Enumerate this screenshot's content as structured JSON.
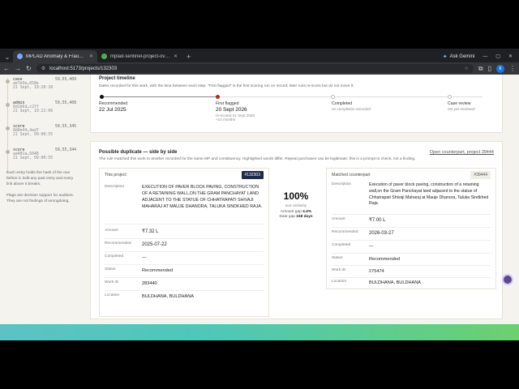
{
  "browser": {
    "tabs": [
      {
        "title": "MPLAD Anomaly & Fraud Dete",
        "active": true
      },
      {
        "title": "mplad-sentinel-project-overvie",
        "active": false
      }
    ],
    "ask_gemini": "Ask Gemini",
    "url": "localhost:5173/projects/132303",
    "profile_initial": "k"
  },
  "audit_log": {
    "entries": [
      {
        "kind": "case",
        "hash": "ae7e9e…658e",
        "ts": "21 Sept, 19:20:10",
        "num": "59,55,409"
      },
      {
        "kind": "admin",
        "hash": "6d2b6d…c2ff",
        "ts": "21 Sept, 19:22:06",
        "num": "59,55,408"
      },
      {
        "kind": "score",
        "hash": "8d0e44…4ad7",
        "ts": "21 Sept, 09:00:55",
        "num": "59,55,345"
      },
      {
        "kind": "score",
        "hash": "aa401a…5048",
        "ts": "21 Sept, 09:00:55",
        "num": "59,55,344"
      }
    ],
    "note1": "Each entry holds the hash of the one before it. Edit any past entry and every link above it breaks.",
    "note2": "Flags are decision support for auditors. They are not findings of wrongdoing."
  },
  "timeline": {
    "title": "Project timeline",
    "subtitle": "Dates recorded for this work, with the time between each step. \"First flagged\" is the first scoring run on record; later runs re-score but do not move it.",
    "steps": [
      {
        "label": "Recommended",
        "date": "22 Jul 2025",
        "note": "",
        "color": "#111111"
      },
      {
        "label": "First flagged",
        "date": "20 Sept 2026",
        "note": "re-scored 21 Sept 2026",
        "note2": "+14 months",
        "color": "#b3261e"
      },
      {
        "label": "Completed",
        "date": "",
        "note": "no completion recorded",
        "color": "#ffffff"
      },
      {
        "label": "Case review",
        "date": "",
        "note": "not yet reviewed",
        "color": "#ffffff"
      }
    ]
  },
  "duplicate": {
    "title": "Possible duplicate — side by side",
    "subtitle": "The rule matched this work to another recorded for the same MP and constituency. Highlighted words differ. Repeat purchases can be legitimate; this is a prompt to check, not a finding.",
    "open_link": "Open counterpart, project 39444",
    "similarity": "100%",
    "similarity_label": "text similarity",
    "amount_gap_label": "Amount gap",
    "amount_gap": "4.4%",
    "date_gap_label": "Date gap",
    "date_gap": "248 days",
    "this_project": {
      "header": "This project",
      "id": "#132303",
      "labels": {
        "description": "Description",
        "amount": "Amount",
        "recommended": "Recommended",
        "completed": "Completed",
        "status": "Status",
        "work_id": "Work ID",
        "location": "Location"
      },
      "description": "EXECUTION OF PAVER BLOCK PAVING, CONSTRUCTION OF A RETAINING WALL,ON THE GRAM PANCHAYAT LAND ADJACENT TO THE STATUE OF CHHATRAPATI SHIVAJI MAHARAJ AT MAUJE DHANORA, TALUKA SINDKHED RAJA.",
      "amount": "₹7.32 L",
      "recommended": "2025-07-22",
      "completed": "—",
      "status": "Recommended",
      "work_id": "283440",
      "location": "BULDHANA, BULDHANA"
    },
    "counterpart": {
      "header": "Matched counterpart",
      "id": "#39444",
      "labels": {
        "description": "Description",
        "amount": "Amount",
        "recommended": "Recommended",
        "completed": "Completed",
        "status": "Status",
        "work_id": "Work ID",
        "location": "Location"
      },
      "description": "Execution of paver block paving, construction of a retaining wall,on the Gram Panchayat land adjacent to the statue of Chhatrapati Shivaji Maharaj at Mauje Dhanora, Taluka Sindkhed Raja.",
      "amount": "₹7.00 L",
      "recommended": "2026-03-27",
      "completed": "—",
      "status": "Recommended",
      "work_id": "275474",
      "location": "BULDHANA, BULDHANA"
    }
  }
}
